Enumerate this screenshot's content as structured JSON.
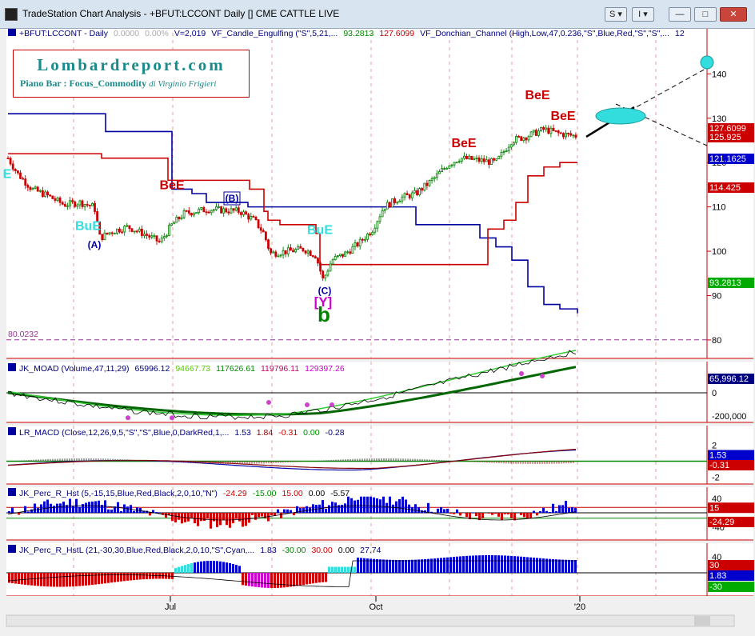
{
  "window": {
    "title": "TradeStation Chart Analysis - +BFUT:LCCONT Daily [] CME CATTLE LIVE",
    "btn_s": "S",
    "btn_i": "I",
    "btn_min": "—",
    "btn_max": "□",
    "btn_close": "✕"
  },
  "logo": {
    "name": "Lombardreport.com",
    "subtitle": "Piano Bar : Focus_Commodity",
    "author": "di Virginio Frigieri"
  },
  "colors": {
    "donchian_upper": "#0000a0",
    "donchian_lower": "#cc0000",
    "up_bar": "#008000",
    "down_bar": "#cc0000",
    "background": "#ffffff",
    "label_bg_blue": "#0000cc",
    "label_bg_red": "#cc0000",
    "label_bg_green": "#00aa00",
    "cyan": "#33dddd"
  },
  "chart_data": [
    {
      "type": "line",
      "title": "+BFUT:LCCONT - Daily",
      "status_parts": [
        {
          "text": "+BFUT:LCCONT - Daily",
          "color": "#000080"
        },
        {
          "text": "0.0000",
          "color": "#aaaaaa"
        },
        {
          "text": "0.00%",
          "color": "#aaaaaa"
        },
        {
          "text": "V=2,019",
          "color": "#000080"
        },
        {
          "text": "VF_Candle_Engulfing (\"S\",5,21,...",
          "color": "#000080"
        },
        {
          "text": "93.2813",
          "color": "#008800"
        },
        {
          "text": "127.6099",
          "color": "#cc0000"
        },
        {
          "text": "VF_Donchian_Channel (High,Low,47,0.236,\"S\",Blue,Red,\"S\",\"S\",...",
          "color": "#000080"
        },
        {
          "text": "12",
          "color": "#000080"
        }
      ],
      "y_ticks": [
        "140",
        "130",
        "120",
        "110",
        "100",
        "90",
        "80"
      ],
      "ylim": [
        78,
        148
      ],
      "x_ticks": [
        "Jul",
        "Oct",
        "'20"
      ],
      "price_labels": [
        {
          "text": "127.6099",
          "bg": "#cc0000",
          "y": 127.6
        },
        {
          "text": "125.925",
          "bg": "#cc0000",
          "y": 125.9
        },
        {
          "text": "121.1625",
          "bg": "#0000cc",
          "y": 121.2
        },
        {
          "text": "114.425",
          "bg": "#cc0000",
          "y": 114.4
        },
        {
          "text": "93.2813",
          "bg": "#00aa00",
          "y": 93.3
        }
      ],
      "hline": {
        "value": 80.0232,
        "label": "80.0232",
        "color": "#993399"
      },
      "annotations": [
        {
          "text": "BeE",
          "color": "#cc0000",
          "pos": [
            215,
            114
          ]
        },
        {
          "text": "BeE",
          "color": "#cc0000",
          "pos": [
            580,
            123.5
          ]
        },
        {
          "text": "BeE",
          "color": "#cc0000",
          "pos": [
            672,
            134.3
          ]
        },
        {
          "text": "BeE",
          "color": "#cc0000",
          "pos": [
            704,
            129.6
          ]
        },
        {
          "text": "BuE",
          "color": "#33dddd",
          "pos": [
            110,
            104.8
          ]
        },
        {
          "text": "BuE",
          "color": "#33dddd",
          "pos": [
            400,
            103.9
          ]
        },
        {
          "text": "E",
          "color": "#33dddd",
          "pos": [
            9,
            116.5
          ]
        },
        {
          "text": "(A)",
          "color": "#0000a0",
          "pos": [
            118,
            100.7
          ]
        },
        {
          "text": "(B)",
          "color": "#0000a0",
          "pos": [
            290,
            111.2
          ]
        },
        {
          "text": "(C)",
          "color": "#0000a0",
          "pos": [
            406,
            90.4
          ]
        },
        {
          "text": "[Y]",
          "color": "#cc00cc",
          "pos": [
            404,
            87.6
          ]
        },
        {
          "text": "b",
          "color": "#008000",
          "pos": [
            405,
            84.1
          ]
        }
      ],
      "series": [
        {
          "name": "Donchian upper",
          "color": "#0000a0",
          "points": [
            [
              10,
              131
            ],
            [
              120,
              131
            ],
            [
              132,
              127
            ],
            [
              200,
              127
            ],
            [
              215,
              114
            ],
            [
              240,
              113
            ],
            [
              258,
              111
            ],
            [
              300,
              111
            ],
            [
              310,
              110
            ],
            [
              470,
              110
            ],
            [
              520,
              106
            ],
            [
              600,
              103
            ],
            [
              620,
              101
            ],
            [
              640,
              98
            ],
            [
              660,
              92
            ],
            [
              680,
              88
            ],
            [
              700,
              87
            ],
            [
              722,
              86
            ]
          ]
        },
        {
          "name": "Donchian lower",
          "color": "#cc0000",
          "points": [
            [
              10,
              122
            ],
            [
              120,
              122
            ],
            [
              127,
              121
            ],
            [
              200,
              121
            ],
            [
              210,
              116
            ],
            [
              300,
              116
            ],
            [
              312,
              114
            ],
            [
              330,
              109
            ],
            [
              335,
              107
            ],
            [
              350,
              106
            ],
            [
              395,
              104
            ],
            [
              400,
              97
            ],
            [
              595,
              97
            ],
            [
              610,
              105
            ],
            [
              630,
              107
            ],
            [
              645,
              111
            ],
            [
              660,
              117
            ],
            [
              680,
              119
            ],
            [
              700,
              120
            ],
            [
              722,
              120
            ]
          ]
        }
      ]
    },
    {
      "type": "line",
      "title": "JK_MOAD (Volume,47,11,29)",
      "status_parts": [
        {
          "text": "JK_MOAD (Volume,47,11,29)",
          "color": "#000080"
        },
        {
          "text": "65996.12",
          "color": "#000080"
        },
        {
          "text": "94667.73",
          "color": "#55cc00"
        },
        {
          "text": "117626.61",
          "color": "#008800"
        },
        {
          "text": "119796.11",
          "color": "#cc0066"
        },
        {
          "text": "129397.26",
          "color": "#cc00cc"
        }
      ],
      "y_ticks": [
        "0",
        "-200,000"
      ],
      "value_label": {
        "text": "65,996.12",
        "bg": "#000080"
      }
    },
    {
      "type": "line",
      "title": "LR_MACD (Close,12,26,9,5,\"S\",\"S\",Blue,0,DarkRed,1,...",
      "status_parts": [
        {
          "text": "LR_MACD (Close,12,26,9,5,\"S\",\"S\",Blue,0,DarkRed,1,...",
          "color": "#000080"
        },
        {
          "text": "1.53",
          "color": "#000080"
        },
        {
          "text": "1.84",
          "color": "#880000"
        },
        {
          "text": "-0.31",
          "color": "#cc0000"
        },
        {
          "text": "0.00",
          "color": "#008800"
        },
        {
          "text": "-0.28",
          "color": "#000080"
        }
      ],
      "y_ticks": [
        "2",
        "0",
        "-2"
      ],
      "value_labels": [
        {
          "text": "1.53",
          "bg": "#0000cc"
        },
        {
          "text": "-0.31",
          "bg": "#cc0000"
        }
      ]
    },
    {
      "type": "bar",
      "title": "JK_Perc_R_Hst (5,-15,15,Blue,Red,Black,2,0,10,\"N\")",
      "status_parts": [
        {
          "text": "JK_Perc_R_Hst (5,-15,15,Blue,Red,Black,2,0,10,\"N\")",
          "color": "#000080"
        },
        {
          "text": "-24.29",
          "color": "#cc0000"
        },
        {
          "text": "-15.00",
          "color": "#008800"
        },
        {
          "text": "15.00",
          "color": "#cc0000"
        },
        {
          "text": "0.00",
          "color": "#000000"
        },
        {
          "text": "-5.57",
          "color": "#000000"
        }
      ],
      "y_ticks": [
        "40",
        "-40"
      ],
      "value_labels": [
        {
          "text": "15",
          "bg": "#cc0000"
        },
        {
          "text": "-24.29",
          "bg": "#cc0000"
        }
      ]
    },
    {
      "type": "bar",
      "title": "JK_Perc_R_HstL (21,-30,30,Blue,Red,Black,2,0,10,\"S\",Cyan,...",
      "status_parts": [
        {
          "text": "JK_Perc_R_HstL (21,-30,30,Blue,Red,Black,2,0,10,\"S\",Cyan,...",
          "color": "#000080"
        },
        {
          "text": "1.83",
          "color": "#000080"
        },
        {
          "text": "-30.00",
          "color": "#008800"
        },
        {
          "text": "30.00",
          "color": "#cc0000"
        },
        {
          "text": "0.00",
          "color": "#000000"
        },
        {
          "text": "27.74",
          "color": "#000080"
        }
      ],
      "y_ticks": [
        "40"
      ],
      "value_labels": [
        {
          "text": "30",
          "bg": "#cc0000"
        },
        {
          "text": "1.83",
          "bg": "#0000cc"
        },
        {
          "text": "-30",
          "bg": "#00aa00"
        }
      ]
    }
  ]
}
